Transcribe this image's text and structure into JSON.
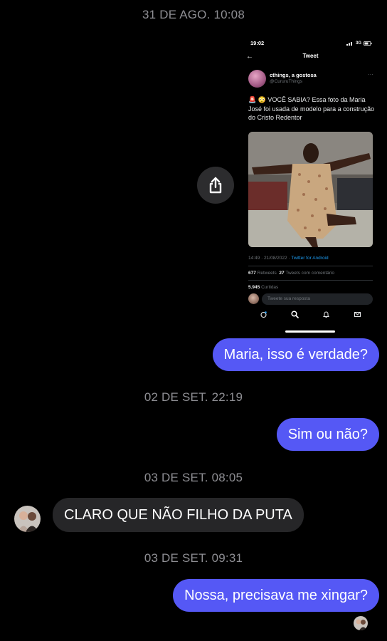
{
  "timestamps": [
    "31 DE AGO. 10:08",
    "02 DE SET. 22:19",
    "03 DE SET. 08:05",
    "03 DE SET. 09:31"
  ],
  "share_icon": "share-icon",
  "screenshot": {
    "status_time": "19:02",
    "status_network": "3G",
    "nav_title": "Tweet",
    "author_name": "cthings, a gostosa",
    "author_handle": "@CururuThings",
    "tweet_text": "🚨 😳 VOCÊ SABIA? Essa foto da Maria José foi usada de modelo para a construção do Cristo Redentor",
    "timestamp_text": "14:49 · 21/08/2022 · ",
    "source": "Twitter for Android",
    "retweets_count": "677",
    "retweets_label": "Retweets",
    "quotes_count": "27",
    "quotes_label": "Tweets com comentário",
    "likes_count": "5.945",
    "likes_label": "Curtidas",
    "reply_placeholder": "Tweete sua resposta"
  },
  "messages": [
    {
      "direction": "outgoing",
      "text": "Maria, isso é verdade?"
    },
    {
      "direction": "outgoing",
      "text": "Sim ou não?"
    },
    {
      "direction": "incoming",
      "text": "CLARO QUE NÃO FILHO DA PUTA"
    },
    {
      "direction": "outgoing",
      "text": "Nossa, precisava me xingar?"
    }
  ],
  "colors": {
    "background": "#000000",
    "outgoing_bubble": "#5558f5",
    "incoming_bubble": "#262628",
    "timestamp": "#8e8e93"
  }
}
